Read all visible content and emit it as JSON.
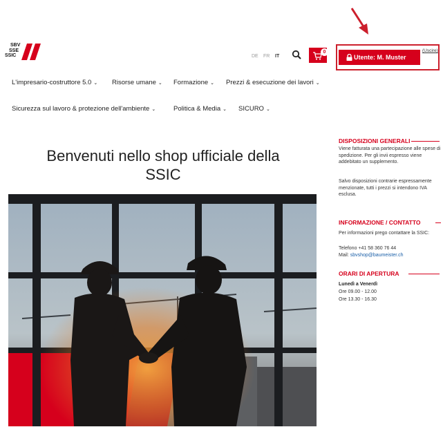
{
  "logo": {
    "line1": "SBV",
    "line2": "SSE",
    "line3": "SSIC"
  },
  "header": {
    "languages": [
      "DE",
      "FR",
      "IT"
    ],
    "active_language": "IT",
    "cart_count": "0",
    "user_button_label": "Utente: M. Muster",
    "logout_label": "(Uscire)",
    "icons": [
      "search-icon",
      "cart-icon",
      "lock-icon"
    ]
  },
  "nav": {
    "row1": [
      "L'impresario-costruttore 5.0",
      "Risorse umane",
      "Formazione",
      "Prezzi & esecuzione dei lavori"
    ],
    "row2": [
      "Sicurezza sul lavoro & protezione dell'ambiente",
      "Politica & Media",
      "SICURO"
    ]
  },
  "main": {
    "headline_line1": "Benvenuti nello shop ufficiale della",
    "headline_line2": "SSIC"
  },
  "sidebar": {
    "general": {
      "title": "DISPOSIZIONI GENERALI",
      "text1": "Viene fatturata una partecipazione alle spese di spedizione. Per gli invii espresso viene addebitato un supplemento.",
      "text2": "Salvo disposizioni contrarie espressamente menzionate, tutti i prezzi si intendono IVA esclusa."
    },
    "contact": {
      "title": "INFORMAZIONE / CONTATTO",
      "text": "Per informazioni prego contattare la SSIC:",
      "phone": "Telefono +41 58 360 76 44",
      "mail_label": "Mail:",
      "mail": "sbvshop@baumeister.ch"
    },
    "hours": {
      "title": "ORARI DI APERTURA",
      "days": "Lunedì a Venerdì",
      "morning": "Ore 09.00 - 12.00",
      "afternoon": "Ore 13.30 - 16.30"
    }
  },
  "colors": {
    "accent": "#d6001c",
    "annotation": "#cc1f2c",
    "link": "#1a5fa8"
  }
}
